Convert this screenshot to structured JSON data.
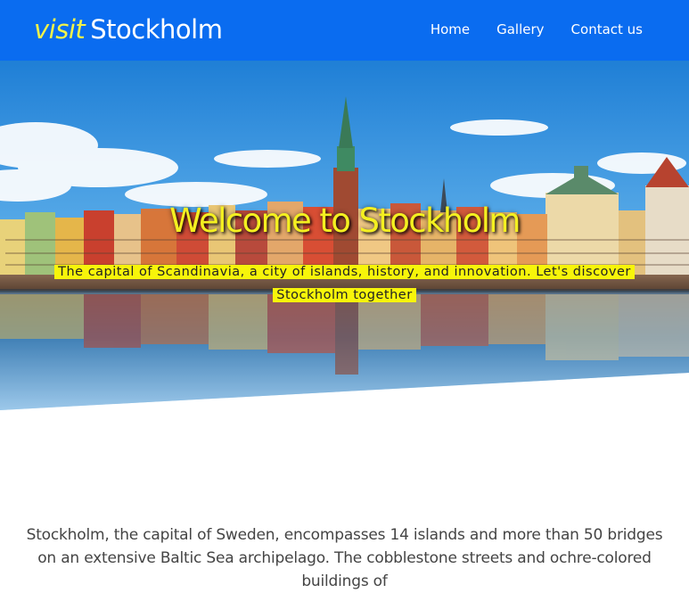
{
  "nav": {
    "brand_accent": "visit",
    "brand_name": "Stockholm",
    "links": [
      {
        "label": "Home"
      },
      {
        "label": "Gallery"
      },
      {
        "label": "Contact us"
      }
    ]
  },
  "hero": {
    "title": "Welcome to Stockholm",
    "subtitle": "The capital of Scandinavia, a city of islands, history, and innovation. Let's discover Stockholm together"
  },
  "intro": {
    "text": "Stockholm, the capital of Sweden, encompasses 14 islands and more than 50 bridges on an extensive Baltic Sea archipelago. The cobblestone streets and ochre-colored buildings of"
  },
  "colors": {
    "navbar": "#0a6cf0",
    "brand_accent": "#f3f34a",
    "hero_title": "#f4f020",
    "subtitle_highlight": "#f7f50a"
  }
}
